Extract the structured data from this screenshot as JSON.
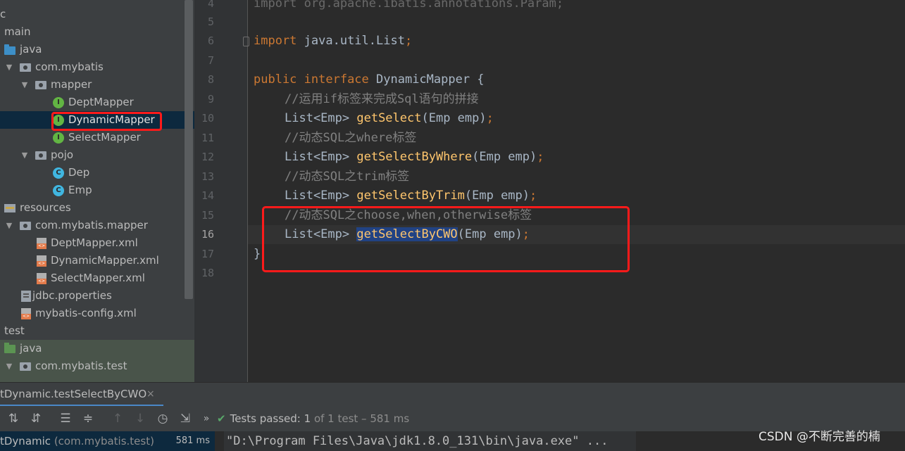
{
  "project_tree": {
    "items": [
      {
        "label": "main",
        "icon": "folder-icon"
      },
      {
        "label": "java",
        "icon": "source-folder-icon"
      },
      {
        "label": "com.mybatis",
        "icon": "package-icon"
      },
      {
        "label": "mapper",
        "icon": "package-icon"
      },
      {
        "label": "DeptMapper",
        "icon": "interface-icon"
      },
      {
        "label": "DynamicMapper",
        "icon": "interface-icon"
      },
      {
        "label": "SelectMapper",
        "icon": "interface-icon"
      },
      {
        "label": "pojo",
        "icon": "package-icon"
      },
      {
        "label": "Dep",
        "icon": "class-icon"
      },
      {
        "label": "Emp",
        "icon": "class-icon"
      },
      {
        "label": "resources",
        "icon": "resources-folder-icon"
      },
      {
        "label": "com.mybatis.mapper",
        "icon": "package-icon"
      },
      {
        "label": "DeptMapper.xml",
        "icon": "xml-file-icon"
      },
      {
        "label": "DynamicMapper.xml",
        "icon": "xml-file-icon"
      },
      {
        "label": "SelectMapper.xml",
        "icon": "xml-file-icon"
      },
      {
        "label": "jdbc.properties",
        "icon": "properties-file-icon"
      },
      {
        "label": "mybatis-config.xml",
        "icon": "xml-file-icon"
      },
      {
        "label": "test",
        "icon": "folder-icon"
      },
      {
        "label": "java",
        "icon": "test-folder-icon"
      },
      {
        "label": "com.mybatis.test",
        "icon": "package-icon"
      }
    ],
    "partial_top": "c",
    "interface_letter": "I",
    "class_letter": "C"
  },
  "editor": {
    "line_numbers": [
      "4",
      "5",
      "6",
      "7",
      "8",
      "9",
      "10",
      "11",
      "12",
      "13",
      "14",
      "15",
      "16",
      "17",
      "18"
    ],
    "current_line": "16",
    "lines": {
      "l4": "import org.apache.ibatis.annotations.Param;",
      "l6_kw": "import",
      "l6_rest": " java.util.List",
      "l6_semi": ";",
      "l8_kw1": "public",
      "l8_kw2": " interface",
      "l8_rest": " DynamicMapper {",
      "l9": "//运用if标签来完成Sql语句的拼接",
      "l10_type": "List<Emp> ",
      "l10_fn": "getSelect",
      "l10_args": "(Emp emp)",
      "l11": "//动态SQL之where标签",
      "l12_type": "List<Emp> ",
      "l12_fn": "getSelectByWhere",
      "l12_args": "(Emp emp)",
      "l13": "//动态SQL之trim标签",
      "l14_type": "List<Emp> ",
      "l14_fn": "getSelectByTrim",
      "l14_args": "(Emp emp)",
      "l15": "//动态SQL之choose,when,otherwise标签",
      "l16_type": "List<Emp> ",
      "l16_fn": "getSelectByCWO",
      "l16_args": "(Emp emp)",
      "semi": ";",
      "l17": "}"
    }
  },
  "run_panel": {
    "tab_label": "tDynamic.testSelectByCWO",
    "tab_close": "×",
    "status_check": "✔",
    "status_prefix": "Tests passed: ",
    "status_count": "1",
    "status_detail": " of 1 test – 581 ms",
    "test_node_name": "tDynamic",
    "test_node_pkg": " (com.mybatis.test)",
    "test_node_time": "581 ms",
    "console_text": "\"D:\\Program Files\\Java\\jdk1.8.0_131\\bin\\java.exe\" ...",
    "more_chevron": "»"
  },
  "watermark": "CSDN @不断完善的楠"
}
